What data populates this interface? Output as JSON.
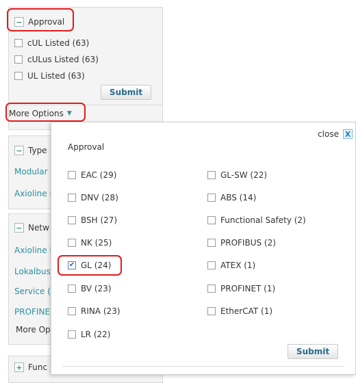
{
  "approval_panel": {
    "title": "Approval",
    "toggle_symbol": "−",
    "items": [
      {
        "label": "cUL Listed (63)",
        "checked": false
      },
      {
        "label": "cULus Listed (63)",
        "checked": false
      },
      {
        "label": "UL Listed (63)",
        "checked": false
      }
    ],
    "submit_label": "Submit",
    "more_options_label": "More Options"
  },
  "type_panel": {
    "title": "Type",
    "toggle_symbol": "−",
    "links": [
      "Modular (",
      "Axioline ("
    ]
  },
  "network_panel": {
    "title": "Netw",
    "toggle_symbol": "−",
    "links": [
      "Axioline I",
      "Lokalbus",
      "Service (",
      "PROFINE"
    ],
    "more_options_label": "More Opt"
  },
  "function_panel": {
    "title": "Func",
    "toggle_symbol": "+"
  },
  "popup": {
    "close_label": "close",
    "close_symbol": "X",
    "title": "Approval",
    "left_column": [
      {
        "label": "EAC (29)",
        "checked": false
      },
      {
        "label": "DNV (28)",
        "checked": false
      },
      {
        "label": "BSH (27)",
        "checked": false
      },
      {
        "label": "NK (25)",
        "checked": false
      },
      {
        "label": "GL (24)",
        "checked": true
      },
      {
        "label": "BV (23)",
        "checked": false
      },
      {
        "label": "RINA (23)",
        "checked": false
      },
      {
        "label": "LR (22)",
        "checked": false
      }
    ],
    "right_column": [
      {
        "label": "GL-SW (22)",
        "checked": false
      },
      {
        "label": "ABS (14)",
        "checked": false
      },
      {
        "label": "Functional Safety (2)",
        "checked": false
      },
      {
        "label": "PROFIBUS (2)",
        "checked": false
      },
      {
        "label": "ATEX (1)",
        "checked": false
      },
      {
        "label": "PROFINET (1)",
        "checked": false
      },
      {
        "label": "EtherCAT (1)",
        "checked": false
      }
    ],
    "submit_label": "Submit"
  },
  "colors": {
    "link": "#2b8fa0",
    "highlight": "#e21b1b",
    "button_text": "#2a6b8a"
  }
}
